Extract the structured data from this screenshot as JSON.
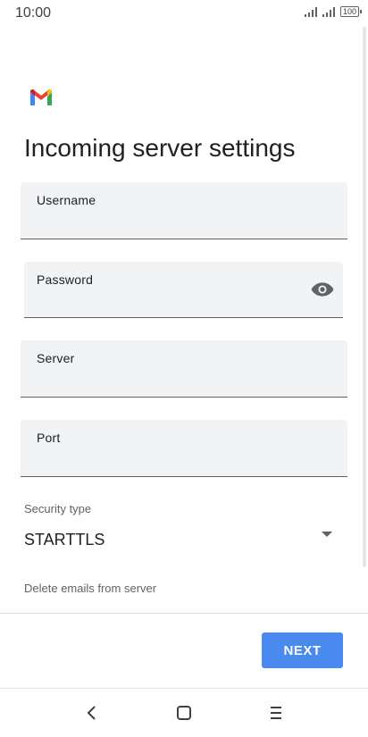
{
  "status_bar": {
    "time": "10:00",
    "battery": "100",
    "icons": [
      "signal-icon",
      "signal-icon",
      "battery-icon"
    ]
  },
  "header": {
    "logo": "gmail-logo",
    "title": "Incoming server settings"
  },
  "form": {
    "username": {
      "label": "Username",
      "value": ""
    },
    "password": {
      "label": "Password",
      "value": "",
      "toggle_icon": "eye-icon"
    },
    "server": {
      "label": "Server",
      "value": ""
    },
    "port": {
      "label": "Port",
      "value": ""
    },
    "security_type": {
      "label": "Security type",
      "value": "STARTTLS",
      "icon": "dropdown-arrow-icon"
    },
    "delete_emails": {
      "label": "Delete emails from server"
    }
  },
  "footer": {
    "next_label": "NEXT"
  },
  "navigation": {
    "items": [
      "back-icon",
      "home-icon",
      "menu-icon"
    ]
  },
  "colors": {
    "accent": "#4a89f0",
    "field_bg": "#f1f3f4",
    "text": "#202124",
    "muted": "#5f6368"
  }
}
